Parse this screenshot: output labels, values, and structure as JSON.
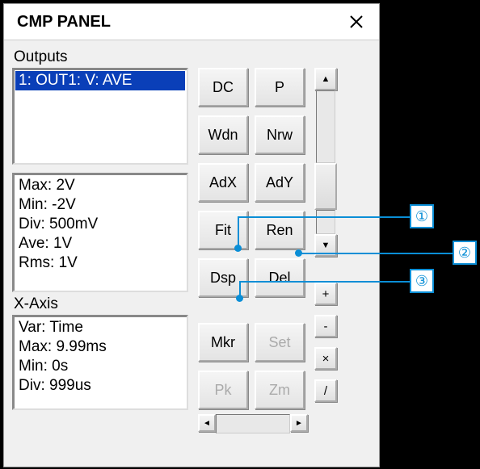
{
  "window": {
    "title": "CMP PANEL"
  },
  "outputs": {
    "label": "Outputs",
    "items": [
      "1: OUT1: V: AVE"
    ]
  },
  "stats": {
    "max": "Max: 2V",
    "min": "Min: -2V",
    "div": "Div: 500mV",
    "ave": "Ave: 1V",
    "rms": "Rms: 1V"
  },
  "xaxis": {
    "label": "X-Axis",
    "var": "Var: Time",
    "max": "Max: 9.99ms",
    "min": "Min: 0s",
    "div": "Div: 999us"
  },
  "buttons": {
    "dc": "DC",
    "p": "P",
    "wdn": "Wdn",
    "nrw": "Nrw",
    "adx": "AdX",
    "ady": "AdY",
    "fit": "Fit",
    "ren": "Ren",
    "dsp": "Dsp",
    "del": "Del",
    "mkr": "Mkr",
    "set": "Set",
    "pk": "Pk",
    "zm": "Zm"
  },
  "side": {
    "plus": "+",
    "minus": "-",
    "times": "×",
    "slash": "/"
  },
  "callouts": {
    "c1": "①",
    "c2": "②",
    "c3": "③"
  }
}
